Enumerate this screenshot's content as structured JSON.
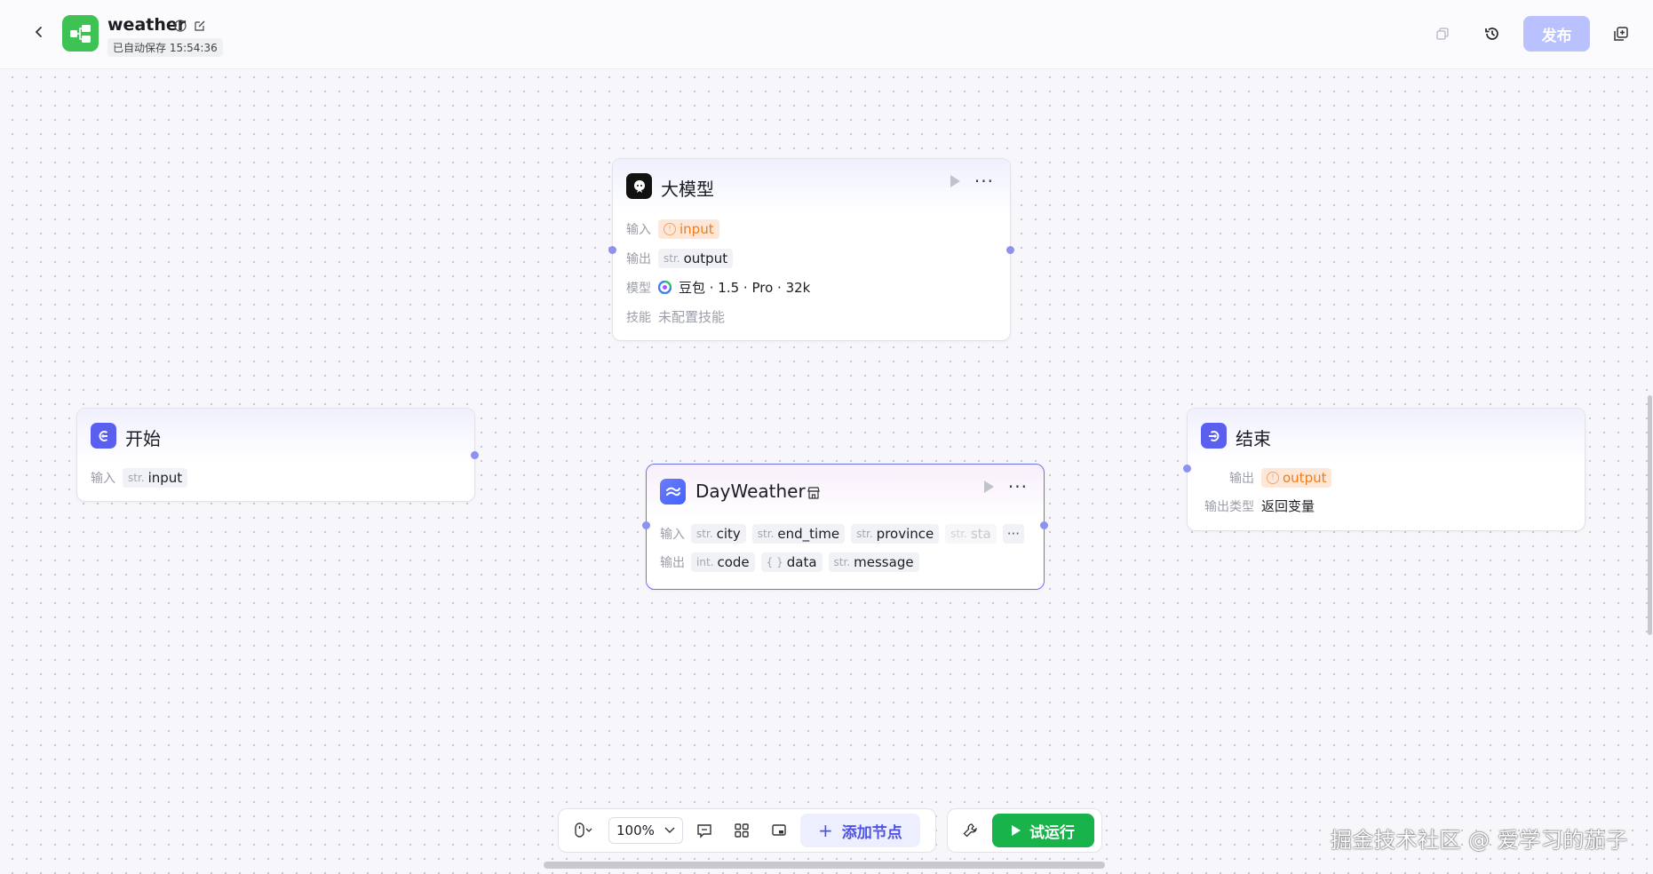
{
  "header": {
    "title": "weather",
    "autosave": "已自动保存 15:54:36",
    "publish_label": "发布"
  },
  "nodes": {
    "llm": {
      "title": "大模型",
      "input_label": "输入",
      "input_tag": "input",
      "output_label": "输出",
      "output_type": "str.",
      "output_name": "output",
      "model_label": "模型",
      "model_value": "豆包 · 1.5 · Pro · 32k",
      "skill_label": "技能",
      "skill_value": "未配置技能"
    },
    "start": {
      "title": "开始",
      "input_label": "输入",
      "input_type": "str.",
      "input_name": "input"
    },
    "plugin": {
      "title": "DayWeather",
      "input_label": "输入",
      "inputs": [
        {
          "type": "str.",
          "name": "city"
        },
        {
          "type": "str.",
          "name": "end_time"
        },
        {
          "type": "str.",
          "name": "province"
        },
        {
          "type": "str.",
          "name": "sta"
        }
      ],
      "output_label": "输出",
      "outputs": [
        {
          "type": "int.",
          "name": "code"
        },
        {
          "type": "{ }",
          "name": "data"
        },
        {
          "type": "str.",
          "name": "message"
        }
      ]
    },
    "end": {
      "title": "结束",
      "output_label": "输出",
      "output_tag": "output",
      "output_type_label": "输出类型",
      "output_type_value": "返回变量"
    }
  },
  "toolbar": {
    "zoom": "100%",
    "add_node_label": "添加节点",
    "test_run_label": "试运行"
  },
  "watermark": "掘金技术社区 @ 爱学习的茄子",
  "colors": {
    "accent": "#4d53e8",
    "run_green": "#19b34b",
    "warn": "#f07c1b",
    "app_icon": "#3ec254"
  }
}
